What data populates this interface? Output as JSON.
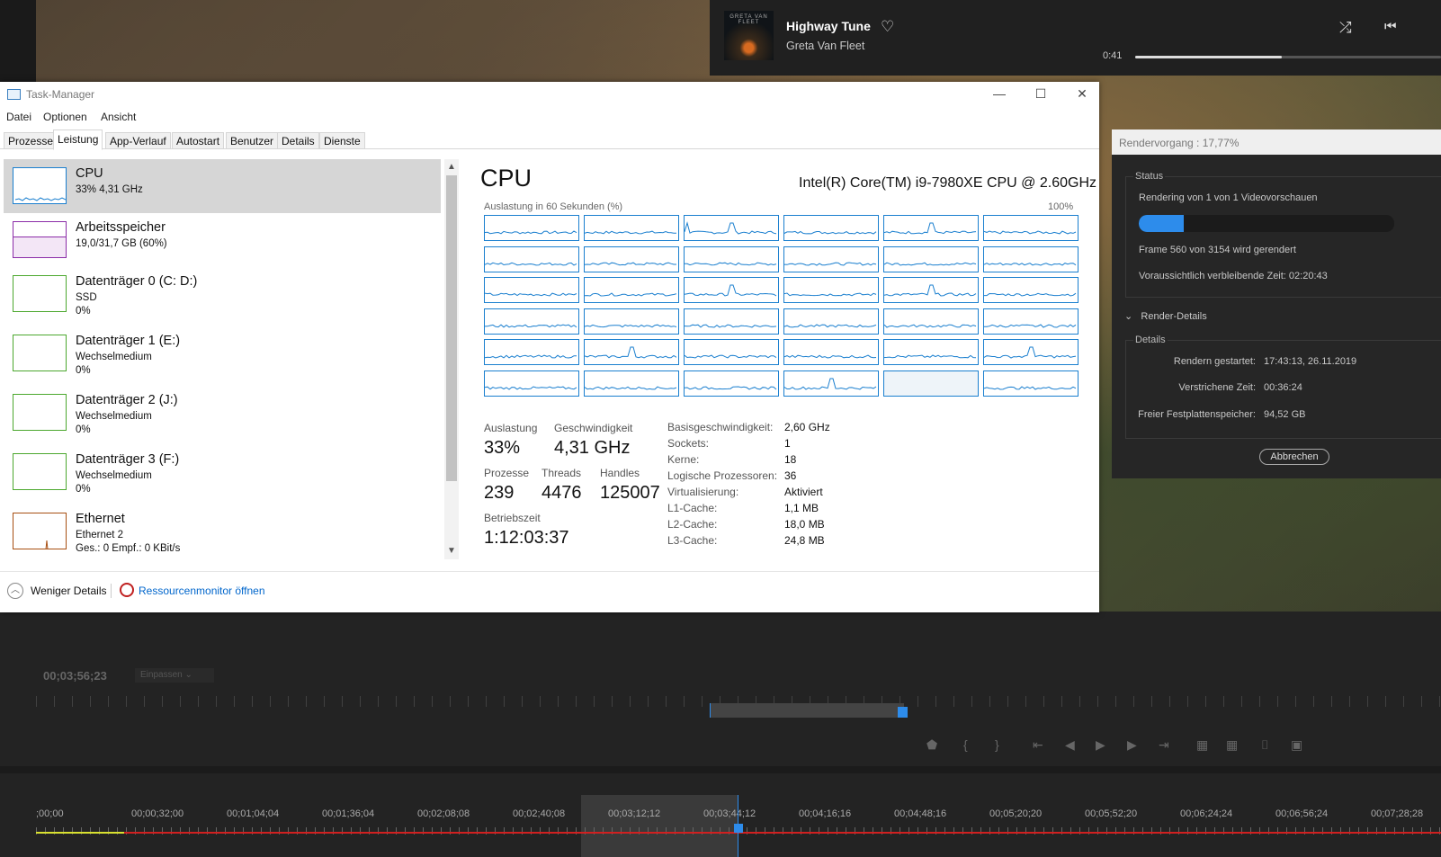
{
  "music": {
    "title": "Highway Tune",
    "artist": "Greta Van Fleet",
    "album_art_text": "GRETA VAN FLEET",
    "time": "0:41",
    "progress": 0.48
  },
  "render": {
    "title": "Rendervorgang : 17,77%",
    "status_label": "Status",
    "line1": "Rendering von 1 von 1 Videovorschauen",
    "progress": 0.1777,
    "frame": "Frame 560 von 3154 wird gerendert",
    "remaining": "Voraussichtlich verbleibende Zeit: 02:20:43",
    "details_toggle": "Render-Details",
    "details_label": "Details",
    "details": [
      {
        "k": "Rendern gestartet:",
        "v": "17:43:13, 26.11.2019"
      },
      {
        "k": "Verstrichene Zeit:",
        "v": "00:36:24"
      },
      {
        "k": "Freier Festplattenspeicher:",
        "v": "94,52 GB"
      }
    ],
    "cancel": "Abbrechen"
  },
  "premiere": {
    "timecode": "00;03;56;23",
    "fit": "Einpassen",
    "sequence_timecodes": [
      ";00;00",
      "00;00;32;00",
      "00;01;04;04",
      "00;01;36;04",
      "00;02;08;08",
      "00;02;40;08",
      "00;03;12;12",
      "00;03;44;12",
      "00;04;16;16",
      "00;04;48;16",
      "00;05;20;20",
      "00;05;52;20",
      "00;06;24;24",
      "00;06;56;24",
      "00;07;28;28"
    ]
  },
  "taskmanager": {
    "title": "Task-Manager",
    "menu": [
      "Datei",
      "Optionen",
      "Ansicht"
    ],
    "tabs": [
      "Prozesse",
      "Leistung",
      "App-Verlauf",
      "Autostart",
      "Benutzer",
      "Details",
      "Dienste"
    ],
    "active_tab": "Leistung",
    "resources": [
      {
        "name": "CPU",
        "sub1": "33% 4,31 GHz",
        "sub2": "",
        "color": "#1a7fcf"
      },
      {
        "name": "Arbeitsspeicher",
        "sub1": "19,0/31,7 GB (60%)",
        "sub2": "",
        "color": "#8b2ca8"
      },
      {
        "name": "Datenträger 0 (C: D:)",
        "sub1": "SSD",
        "sub2": "0%",
        "color": "#4ca82e"
      },
      {
        "name": "Datenträger 1 (E:)",
        "sub1": "Wechselmedium",
        "sub2": "0%",
        "color": "#4ca82e"
      },
      {
        "name": "Datenträger 2 (J:)",
        "sub1": "Wechselmedium",
        "sub2": "0%",
        "color": "#4ca82e"
      },
      {
        "name": "Datenträger 3 (F:)",
        "sub1": "Wechselmedium",
        "sub2": "0%",
        "color": "#4ca82e"
      },
      {
        "name": "Ethernet",
        "sub1": "Ethernet 2",
        "sub2_pre": "Ges.: ",
        "sub2_b1": "0",
        "sub2_mid": " Empf.: ",
        "sub2_b2": "0 KBit/s",
        "color": "#a84f12"
      }
    ],
    "footer": {
      "less": "Weniger Details",
      "resmon": "Ressourcenmonitor öffnen"
    },
    "cpu": {
      "title": "CPU",
      "model": "Intel(R) Core(TM) i9-7980XE CPU @ 2.60GHz",
      "graph_label": "Auslastung in 60 Sekunden (%)",
      "graph_max": "100%",
      "stats": {
        "auslastung_label": "Auslastung",
        "auslastung": "33%",
        "geschwindigkeit_label": "Geschwindigkeit",
        "geschwindigkeit": "4,31 GHz",
        "prozesse_label": "Prozesse",
        "prozesse": "239",
        "threads_label": "Threads",
        "threads": "4476",
        "handles_label": "Handles",
        "handles": "125007",
        "betriebszeit_label": "Betriebszeit",
        "betriebszeit": "1:12:03:37"
      },
      "specs": [
        {
          "k": "Basisgeschwindigkeit:",
          "v": "2,60 GHz"
        },
        {
          "k": "Sockets:",
          "v": "1"
        },
        {
          "k": "Kerne:",
          "v": "18"
        },
        {
          "k": "Logische Prozessoren:",
          "v": "36"
        },
        {
          "k": "Virtualisierung:",
          "v": "Aktiviert"
        },
        {
          "k": "L1-Cache:",
          "v": "1,1 MB"
        },
        {
          "k": "L2-Cache:",
          "v": "18,0 MB"
        },
        {
          "k": "L3-Cache:",
          "v": "24,8 MB"
        }
      ]
    }
  }
}
